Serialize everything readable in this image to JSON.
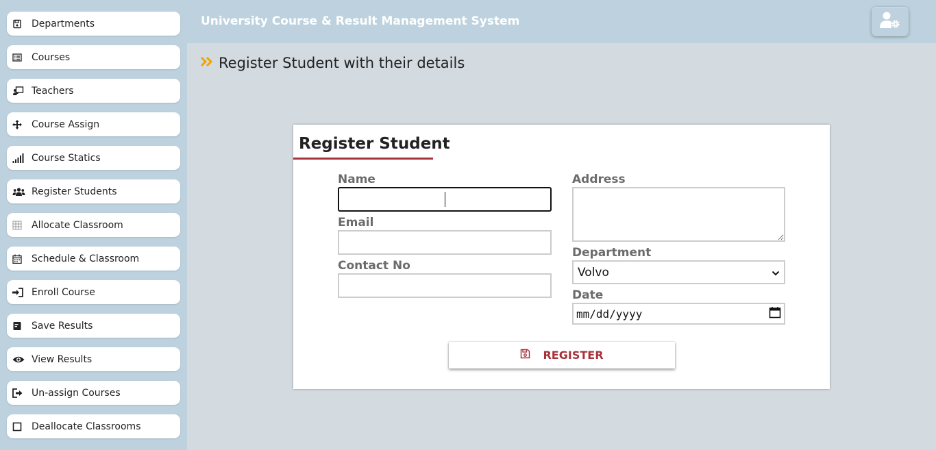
{
  "header": {
    "app_title": "University Course & Result Management System",
    "user_settings_icon": "user-gear-icon"
  },
  "sidebar": {
    "items": [
      {
        "label": "Departments",
        "icon": "floppy-icon"
      },
      {
        "label": "Courses",
        "icon": "list-icon"
      },
      {
        "label": "Teachers",
        "icon": "chalkboard-teacher-icon"
      },
      {
        "label": "Course Assign",
        "icon": "move-arrows-icon"
      },
      {
        "label": "Course Statics",
        "icon": "signal-bars-icon"
      },
      {
        "label": "Register Students",
        "icon": "users-icon"
      },
      {
        "label": "Allocate Classroom",
        "icon": "grid-icon"
      },
      {
        "label": "Schedule & Classroom",
        "icon": "calendar-icon"
      },
      {
        "label": "Enroll Course",
        "icon": "sign-in-icon"
      },
      {
        "label": "Save Results",
        "icon": "file-icon"
      },
      {
        "label": "View Results",
        "icon": "eye-icon"
      },
      {
        "label": "Un-assign Courses",
        "icon": "sign-out-icon"
      },
      {
        "label": "Deallocate Classrooms",
        "icon": "square-icon"
      }
    ]
  },
  "page": {
    "heading": "Register Student with their details"
  },
  "form": {
    "title": "Register Student",
    "name_label": "Name",
    "name_value": "",
    "email_label": "Email",
    "email_value": "",
    "contact_label": "Contact No",
    "contact_value": "",
    "address_label": "Address",
    "address_value": "",
    "department_label": "Department",
    "department_selected": "Volvo",
    "date_label": "Date",
    "date_placeholder": "mm/dd/yyyy",
    "register_label": "REGISTER"
  },
  "colors": {
    "accent": "#a8323a",
    "chevron": "#f5a300",
    "sidebar_bg": "#bdd2de",
    "content_bg": "#d3dae0"
  }
}
